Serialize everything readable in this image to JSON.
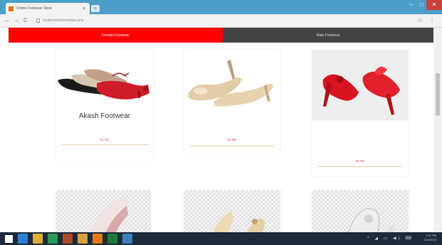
{
  "browser": {
    "tab_title": "Online Footwear Store",
    "tab_close": "×",
    "new_tab": "+",
    "minimize": "–",
    "maximize": "□",
    "close": "✕",
    "back": "←",
    "forward": "→",
    "reload": "C",
    "url": "localhost/shoes/index.php",
    "star": "☆",
    "menu": "⋮"
  },
  "nav": {
    "left_label": "Female Footwear",
    "right_label": "Male Footwear"
  },
  "products": [
    {
      "name": "Akash Footwear",
      "price": "Rs.799"
    },
    {
      "name": "",
      "price": "Rs.899"
    },
    {
      "name": "",
      "price": "Rs.999"
    },
    {
      "name": "",
      "price": ""
    },
    {
      "name": "",
      "price": ""
    },
    {
      "name": "",
      "price": ""
    }
  ],
  "taskbar": {
    "time": "1:01 PM",
    "date": "7/24/2016",
    "tray_icons": "^ ◢ ▭ ◀) ⌨"
  },
  "colors": {
    "accent_red": "#ff0000",
    "nav_dark": "#444444",
    "price_pink": "#e0174a"
  }
}
